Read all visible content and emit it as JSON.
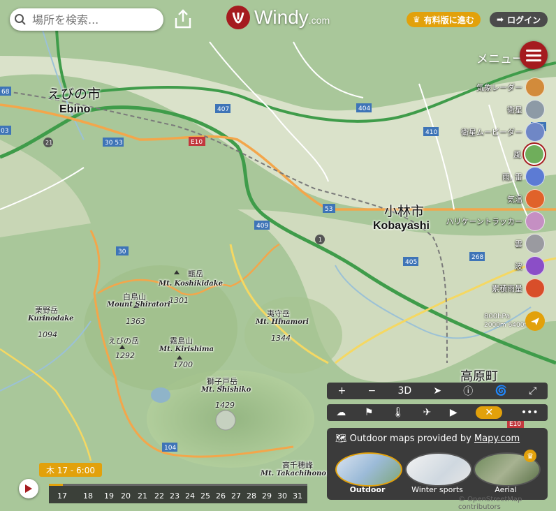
{
  "search": {
    "placeholder": "場所を検索..."
  },
  "logo": {
    "brand": "Windy",
    "suffix": ".com"
  },
  "header": {
    "premium_label": "有料版に進む",
    "login_label": "ログイン",
    "menu_label": "メニュー"
  },
  "layers": [
    {
      "label": "気象レーダー",
      "color": "#d28b3b"
    },
    {
      "label": "衛星",
      "color": "#8d9aa6"
    },
    {
      "label": "衛星ムービーダー",
      "color": "#6f87c6"
    },
    {
      "label": "風",
      "color": "#6fae5b"
    },
    {
      "label": "雨, 雷",
      "color": "#5c7bd4"
    },
    {
      "label": "気温",
      "color": "#e0622a"
    },
    {
      "label": "ハリケーントラッカー",
      "color": "#c58fc3"
    },
    {
      "label": "雲",
      "color": "#9a9aa0"
    },
    {
      "label": "波",
      "color": "#8b4ec7"
    },
    {
      "label": "累積雨量",
      "color": "#d84e2a"
    }
  ],
  "altitude": {
    "level": "800hPa",
    "range": "2000m 6400ft"
  },
  "map_controls": [
    "+",
    "−",
    "3D",
    "➤",
    "ⓘ",
    "🌀",
    "⤢"
  ],
  "map_tools": [
    "☁",
    "⚑",
    "🌡",
    "✈",
    "▶",
    "✕",
    "•••"
  ],
  "outdoor": {
    "header": "Outdoor maps provided by",
    "provider": "Mapy.com",
    "maps": [
      "Outdoor",
      "Winter sports",
      "Aerial"
    ]
  },
  "timeline": {
    "current": "木 17 - 6:00",
    "days": [
      "17",
      "18",
      "19",
      "20",
      "21",
      "22",
      "23",
      "24",
      "25",
      "26",
      "27",
      "28",
      "29",
      "30",
      "31"
    ]
  },
  "credit": "© OpenStreetMap contributors",
  "map_labels": {
    "ebino_jp": "えびの市",
    "ebino_en": "Ebino",
    "kobayashi_jp": "小林市",
    "kobayashi_en": "Kobayashi",
    "takaharu": "高原町",
    "peaks": [
      {
        "jp": "甑岳",
        "en": "Mt. Koshikidake",
        "elev": "1301"
      },
      {
        "jp": "白鳥山",
        "en": "Mount Shiratori",
        "elev": "1363"
      },
      {
        "jp": "夷守岳",
        "en": "Mt. Hinamori",
        "elev": "1344"
      },
      {
        "jp": "霧島山",
        "en": "Mt. Kirishima",
        "elev": "1700"
      },
      {
        "jp": "栗野岳",
        "en": "Kurinodake",
        "elev": "1094"
      },
      {
        "jp": "えびの岳",
        "en": "",
        "elev": "1292"
      },
      {
        "jp": "獅子戸岳",
        "en": "Mt. Shishiko",
        "elev": "1429"
      },
      {
        "jp": "高千穂峰",
        "en": "Mt. Takachihonom",
        "elev": ""
      }
    ],
    "routes": [
      "407",
      "404",
      "410",
      "265",
      "409",
      "53",
      "30",
      "268",
      "405",
      "E10",
      "1",
      "21",
      "30 53",
      "104",
      "E10"
    ]
  }
}
